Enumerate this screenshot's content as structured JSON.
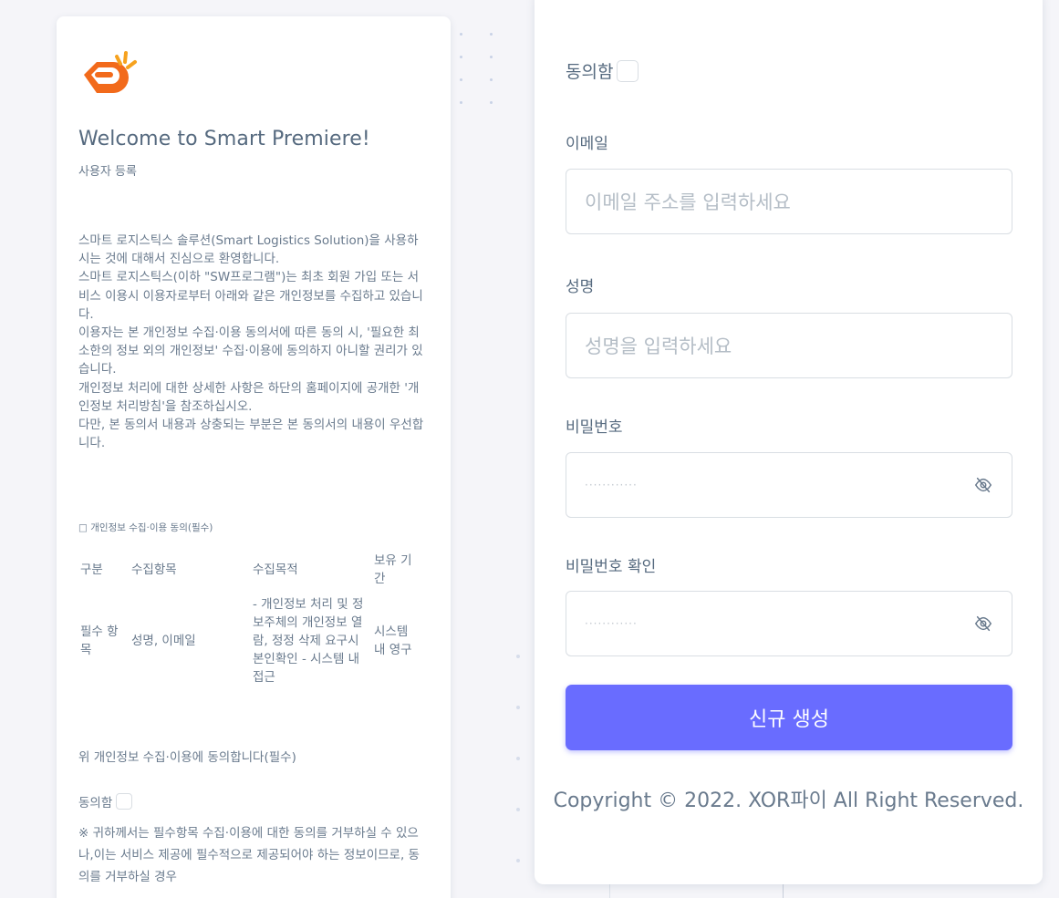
{
  "left_panel": {
    "welcome_title": "Welcome to Smart Premiere!",
    "subtitle": "사용자 등록",
    "terms_paragraphs": [
      "스마트 로지스틱스 솔루션(Smart Logistics Solution)을 사용하시는 것에 대해서 진심으로 환영합니다.",
      "스마트 로지스틱스(이하 \"SW프로그램\")는 최초 회원 가입 또는 서비스 이용시 이용자로부터 아래와 같은 개인정보를 수집하고 있습니다.",
      "이용자는 본 개인정보 수집·이용 동의서에 따른 동의 시, '필요한 최소한의 정보 외의 개인정보' 수집·이용에 동의하지 아니할 권리가 있습니다.",
      "개인정보 처리에 대한 상세한 사항은 하단의 홈페이지에 공개한 '개인정보 처리방침'을 참조하십시오.",
      "다만, 본 동의서 내용과 상충되는 부분은 본 동의서의 내용이 우선합니다."
    ],
    "consent_title": "□ 개인정보 수집·이용 동의(필수)",
    "table": {
      "headers": [
        "구분",
        "수집항목",
        "수집목적",
        "보유 기간"
      ],
      "row": [
        "필수 항목",
        "성명, 이메일",
        "- 개인정보 처리 및 정보주체의 개인정보 열람, 정정 삭제 요구시 본인확인 - 시스템 내 접근",
        "시스템 내 영구"
      ]
    },
    "agree_note": "위 개인정보 수집·이용에 동의합니다(필수)",
    "agree_label": "동의함",
    "notice": "※ 귀하께서는 필수항목 수집·이용에 대한 동의를 거부하실 수 있으나,이는 서비스 제공에 필수적으로 제공되어야 하는 정보이므로, 동의를 거부하실 경우"
  },
  "right_panel": {
    "agree_label": "동의함",
    "email": {
      "label": "이메일",
      "placeholder": "이메일 주소를 입력하세요"
    },
    "name": {
      "label": "성명",
      "placeholder": "성명을 입력하세요"
    },
    "password": {
      "label": "비밀번호",
      "value": "············"
    },
    "password_confirm": {
      "label": "비밀번호 확인",
      "value": "············"
    },
    "submit_label": "신규 생성",
    "copyright": "Copyright © 2022. XOR파이 All Right Reserved."
  },
  "colors": {
    "primary": "#696cff",
    "logo_orange": "#f26a1b",
    "text": "#697a8d",
    "heading": "#566a7f"
  },
  "icons": [
    "brand-logo-icon",
    "eye-off-icon"
  ]
}
